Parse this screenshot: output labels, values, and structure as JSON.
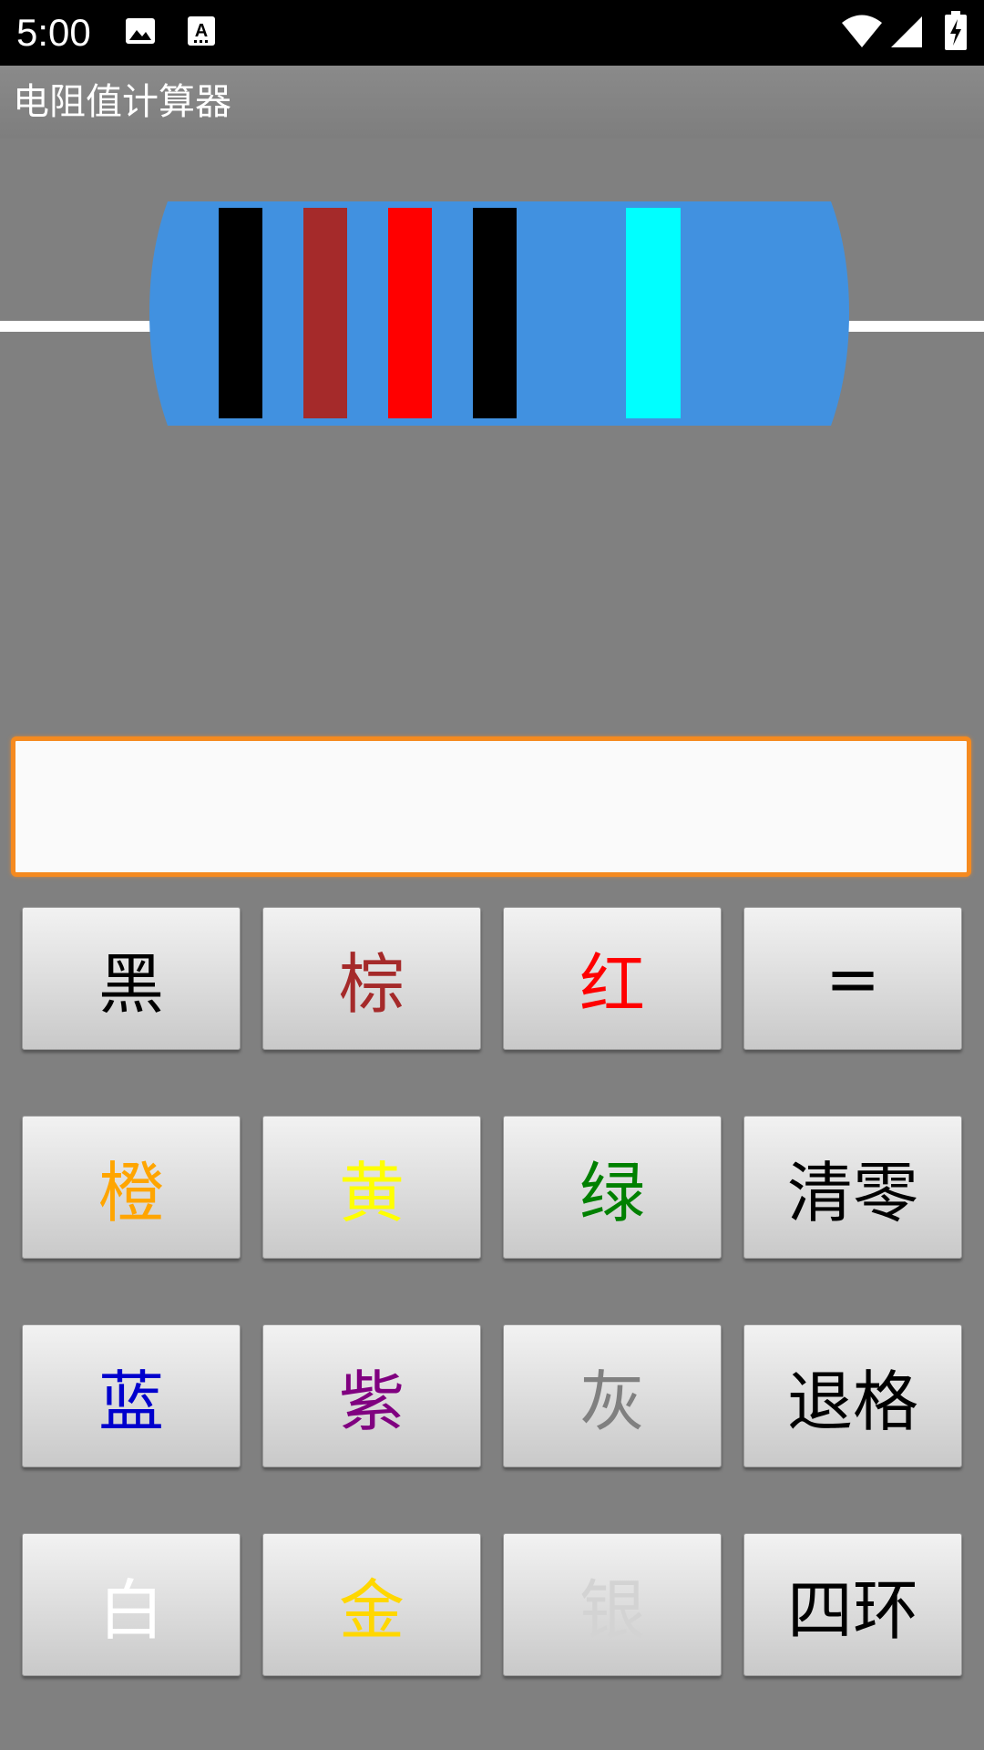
{
  "status_bar": {
    "time": "5:00",
    "icons": [
      "image-icon",
      "text-a-icon",
      "wifi-icon",
      "cell-signal-icon",
      "battery-charging-icon"
    ]
  },
  "app": {
    "title": "电阻值计算器"
  },
  "resistor": {
    "body_color": "#4191e0",
    "lead_color": "#ffffff",
    "bands": [
      {
        "name": "black",
        "color": "#000000"
      },
      {
        "name": "brown",
        "color": "#a52a2a"
      },
      {
        "name": "red",
        "color": "#ff0000"
      },
      {
        "name": "black",
        "color": "#000000"
      },
      {
        "name": "cyan",
        "color": "#00ffff"
      }
    ]
  },
  "display": {
    "value": "",
    "placeholder": "",
    "border_color": "#f58a1f"
  },
  "keypad": {
    "keys": [
      {
        "label": "黑",
        "color": "#000000"
      },
      {
        "label": "棕",
        "color": "#a52a2a"
      },
      {
        "label": "红",
        "color": "#ff0000"
      },
      {
        "label": "=",
        "color": "#000000"
      },
      {
        "label": "橙",
        "color": "#ffa500"
      },
      {
        "label": "黄",
        "color": "#ffff00"
      },
      {
        "label": "绿",
        "color": "#008000"
      },
      {
        "label": "清零",
        "color": "#000000"
      },
      {
        "label": "蓝",
        "color": "#0000cd"
      },
      {
        "label": "紫",
        "color": "#800080"
      },
      {
        "label": "灰",
        "color": "#808080"
      },
      {
        "label": "退格",
        "color": "#000000"
      },
      {
        "label": "白",
        "color": "#ffffff"
      },
      {
        "label": "金",
        "color": "#ffd700"
      },
      {
        "label": "银",
        "color": "#d3d3d3"
      },
      {
        "label": "四环",
        "color": "#000000"
      }
    ]
  }
}
